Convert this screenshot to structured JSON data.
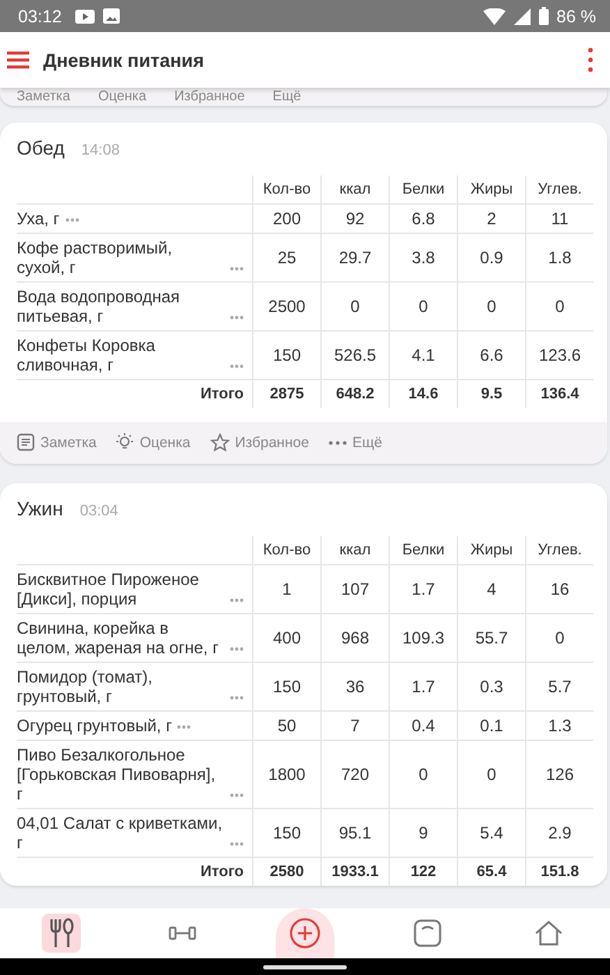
{
  "status_bar": {
    "time": "03:12",
    "battery": "86 %"
  },
  "app_bar": {
    "title": "Дневник питания"
  },
  "previous_actions": [
    "Заметка",
    "Оценка",
    "Избранное",
    "Ещё"
  ],
  "meals": [
    {
      "title": "Обед",
      "time": "14:08",
      "columns": [
        "Кол-во",
        "ккал",
        "Белки",
        "Жиры",
        "Углев."
      ],
      "rows": [
        {
          "name": "Уха, г",
          "values": [
            "200",
            "92",
            "6.8",
            "2",
            "11"
          ]
        },
        {
          "name": "Кофе растворимый, сухой, г",
          "values": [
            "25",
            "29.7",
            "3.8",
            "0.9",
            "1.8"
          ]
        },
        {
          "name": "Вода водопроводная питьевая, г",
          "values": [
            "2500",
            "0",
            "0",
            "0",
            "0"
          ]
        },
        {
          "name": "Конфеты Коровка сливочная, г",
          "values": [
            "150",
            "526.5",
            "4.1",
            "6.6",
            "123.6"
          ]
        }
      ],
      "total": {
        "label": "Итого",
        "values": [
          "2875",
          "648.2",
          "14.6",
          "9.5",
          "136.4"
        ]
      },
      "actions": [
        "Заметка",
        "Оценка",
        "Избранное",
        "Ещё"
      ]
    },
    {
      "title": "Ужин",
      "time": "03:04",
      "columns": [
        "Кол-во",
        "ккал",
        "Белки",
        "Жиры",
        "Углев."
      ],
      "rows": [
        {
          "name": "Бисквитное Пироженое [Дикси], порция",
          "values": [
            "1",
            "107",
            "1.7",
            "4",
            "16"
          ]
        },
        {
          "name": "Свинина, корейка в целом, жареная на огне, г",
          "values": [
            "400",
            "968",
            "109.3",
            "55.7",
            "0"
          ]
        },
        {
          "name": "Помидор (томат), грунтовый, г",
          "values": [
            "150",
            "36",
            "1.7",
            "0.3",
            "5.7"
          ]
        },
        {
          "name": "Огурец грунтовый, г",
          "values": [
            "50",
            "7",
            "0.4",
            "0.1",
            "1.3"
          ]
        },
        {
          "name": "Пиво Безалкогольное [Горьковская Пивоварня], г",
          "values": [
            "1800",
            "720",
            "0",
            "0",
            "126"
          ]
        },
        {
          "name": "04,01 Салат с криветками, г",
          "values": [
            "150",
            "95.1",
            "9",
            "5.4",
            "2.9"
          ]
        }
      ],
      "total": {
        "label": "Итого",
        "values": [
          "2580",
          "1933.1",
          "122",
          "65.4",
          "151.8"
        ]
      }
    }
  ],
  "bottom_nav": [
    {
      "kind": "food",
      "selected": true
    },
    {
      "kind": "exercise",
      "selected": false
    },
    {
      "kind": "add"
    },
    {
      "kind": "scale",
      "selected": false
    },
    {
      "kind": "home",
      "selected": false
    }
  ]
}
